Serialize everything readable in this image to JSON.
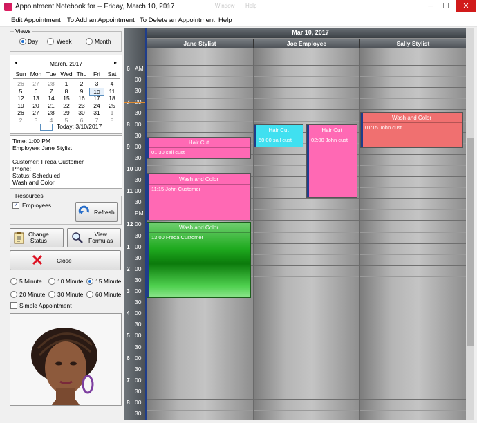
{
  "window": {
    "title": "Appointment Notebook for -- Friday, March 10, 2017",
    "ghost_menu": [
      "Help",
      "Window",
      "Help"
    ],
    "controls": [
      "─",
      "☐",
      "✕"
    ]
  },
  "menu": [
    "Edit Appointment",
    "To Add an Appointment",
    "To Delete an Appointment",
    "Help"
  ],
  "views": {
    "label": "Views",
    "options": [
      "Day",
      "Week",
      "Month"
    ],
    "selected": "Day"
  },
  "calendar": {
    "month_label": "March, 2017",
    "prev": "◂",
    "next": "▸",
    "weekdays": [
      "Sun",
      "Mon",
      "Tue",
      "Wed",
      "Thu",
      "Fri",
      "Sat"
    ],
    "weeks": [
      [
        "26",
        "27",
        "28",
        "1",
        "2",
        "3",
        "4"
      ],
      [
        "5",
        "6",
        "7",
        "8",
        "9",
        "10",
        "11"
      ],
      [
        "12",
        "13",
        "14",
        "15",
        "16",
        "17",
        "18"
      ],
      [
        "19",
        "20",
        "21",
        "22",
        "23",
        "24",
        "25"
      ],
      [
        "26",
        "27",
        "28",
        "29",
        "30",
        "31",
        "1"
      ],
      [
        "2",
        "3",
        "4",
        "5",
        "6",
        "7",
        "8"
      ]
    ],
    "selected_day": "10",
    "today_label": "Today: 3/10/2017"
  },
  "details": [
    "Time: 1:00 PM",
    "Employee: Jane Stylist",
    "",
    "Customer: Freda Customer",
    "Phone:",
    "Status: Scheduled",
    "Wash and Color"
  ],
  "resources": {
    "label": "Resources",
    "employees_label": "Employees",
    "employees_checked": true,
    "refresh_label": "Refresh"
  },
  "buttons": {
    "change_status": "Change\nStatus",
    "view_formulas": "View\nFormulas",
    "close": "Close"
  },
  "intervals": {
    "options": [
      "5 Minute",
      "10 Minute",
      "15 Minute",
      "20 Minute",
      "30 Minute",
      "60 Minute"
    ],
    "selected": "15 Minute",
    "simple_label": "Simple Appointment"
  },
  "schedule": {
    "date": "Mar 10, 2017",
    "resources": [
      "Jane Stylist",
      "Joe Employee",
      "Sally Stylist"
    ],
    "time_labels": [
      {
        "hour": "6",
        "mark": "AM"
      },
      {
        "hour": "",
        "mark": "00"
      },
      {
        "hour": "",
        "mark": "30"
      },
      {
        "hour": "7",
        "mark": "00"
      },
      {
        "hour": "",
        "mark": "30"
      },
      {
        "hour": "8",
        "mark": "00"
      },
      {
        "hour": "",
        "mark": "30"
      },
      {
        "hour": "9",
        "mark": "00"
      },
      {
        "hour": "",
        "mark": "30"
      },
      {
        "hour": "10",
        "mark": "00"
      },
      {
        "hour": "",
        "mark": "30"
      },
      {
        "hour": "11",
        "mark": "00"
      },
      {
        "hour": "",
        "mark": "30"
      },
      {
        "hour": "",
        "mark": "PM"
      },
      {
        "hour": "12",
        "mark": "00"
      },
      {
        "hour": "",
        "mark": "30"
      },
      {
        "hour": "1",
        "mark": "00"
      },
      {
        "hour": "",
        "mark": "30"
      },
      {
        "hour": "2",
        "mark": "00"
      },
      {
        "hour": "",
        "mark": "30"
      },
      {
        "hour": "3",
        "mark": "00"
      },
      {
        "hour": "",
        "mark": "30"
      },
      {
        "hour": "4",
        "mark": "00"
      },
      {
        "hour": "",
        "mark": "30"
      },
      {
        "hour": "5",
        "mark": "00"
      },
      {
        "hour": "",
        "mark": "30"
      },
      {
        "hour": "6",
        "mark": "00"
      },
      {
        "hour": "",
        "mark": "30"
      },
      {
        "hour": "7",
        "mark": "00"
      },
      {
        "hour": "",
        "mark": "30"
      },
      {
        "hour": "8",
        "mark": "00"
      },
      {
        "hour": "",
        "mark": "30"
      }
    ],
    "appointments": [
      {
        "resource": "Jane Stylist",
        "title": "Hair Cut",
        "line": "01:30 sall cust",
        "color": "#ff69b4"
      },
      {
        "resource": "Jane Stylist",
        "title": "Wash and Color",
        "line": "11:15 John Customer",
        "color": "#ff69b4"
      },
      {
        "resource": "Jane Stylist",
        "title": "Wash and Color",
        "line": "13:00 Freda Customer",
        "color": "#2eae2e"
      },
      {
        "resource": "Joe Employee",
        "title": "Hair Cut",
        "line": "50:00 sall cust",
        "color": "#40e0f0"
      },
      {
        "resource": "Joe Employee",
        "title": "Hair Cut",
        "line": "02:00 John cust",
        "color": "#ff69b4"
      },
      {
        "resource": "Sally Stylist",
        "title": "Wash and Color",
        "line": "01:15 John cust",
        "color": "#f07070"
      }
    ]
  }
}
